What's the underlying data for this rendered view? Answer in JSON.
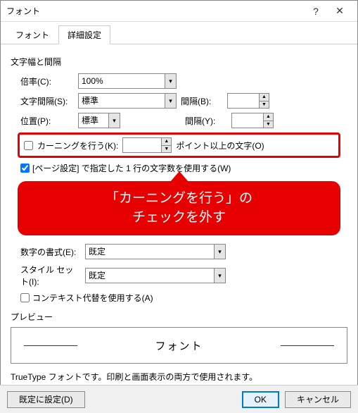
{
  "window": {
    "title": "フォント"
  },
  "tabs": {
    "font": "フォント",
    "advanced": "詳細設定"
  },
  "section1": {
    "title": "文字幅と間隔"
  },
  "scale": {
    "label": "倍率(C):",
    "value": "100%"
  },
  "char_spacing": {
    "label": "文字間隔(S):",
    "value": "標準",
    "gap_label": "間隔(B):",
    "gap_value": ""
  },
  "position": {
    "label": "位置(P):",
    "value": "標準",
    "gap_label": "間隔(Y):",
    "gap_value": ""
  },
  "kerning": {
    "label": "カーニングを行う(K):",
    "value": "",
    "suffix": "ポイント以上の文字(O)"
  },
  "page_setup": {
    "label": "[ページ設定] で指定した 1 行の文字数を使用する(W)"
  },
  "callout": {
    "line1": "「カーニングを行う」の",
    "line2": "チェックを外す"
  },
  "number_format": {
    "label": "数字の書式(E):",
    "value": "既定"
  },
  "style_set": {
    "label": "スタイル セット(I):",
    "value": "既定"
  },
  "context_alt": {
    "label": "コンテキスト代替を使用する(A)"
  },
  "preview": {
    "label": "プレビュー",
    "sample": "フォント"
  },
  "desc": {
    "text": "TrueType フォントです。印刷と画面表示の両方で使用されます。"
  },
  "footer": {
    "set_default": "既定に設定(D)",
    "ok": "OK",
    "cancel": "キャンセル"
  }
}
